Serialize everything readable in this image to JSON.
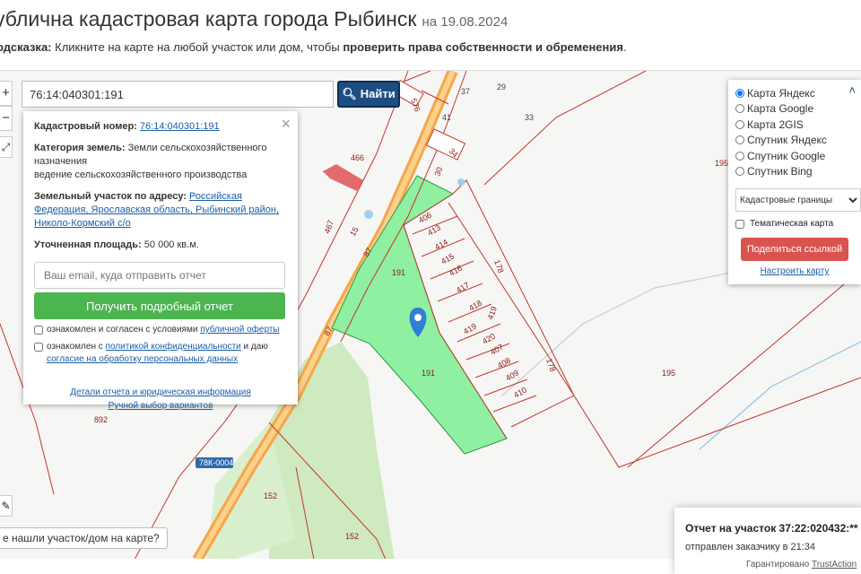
{
  "header": {
    "title": "ублична кадастровая карта города Рыбинск",
    "date": "на 19.08.2024",
    "hint_prefix": "одсказка:",
    "hint_text": " Кликните на карте на любой участок или дом, чтобы ",
    "hint_bold": "проверить права собственности и обременения",
    "hint_end": "."
  },
  "search": {
    "value": "76:14:040301:191",
    "button_label": "Найти"
  },
  "zoom": {
    "plus": "+",
    "minus": "−",
    "fullscreen": "⤢"
  },
  "info": {
    "close": "×",
    "cad_label": "Кадастровый номер:",
    "cad_value": "76:14:040301:191",
    "category_label": "Категория земель:",
    "category_value": "Земли сельскохозяйственного назначения",
    "category_extra": "ведение сельскохозяйственного производства",
    "address_label": "Земельный участок по адресу:",
    "address_value": "Российская Федерация, Ярославская область, Рыбинский район, Николо-Кормский с/о",
    "area_label": "Уточненная площадь:",
    "area_value": "50 000 кв.м.",
    "email_placeholder": "Ваш email, куда отправить отчет",
    "report_button": "Получить подробный отчет",
    "check1_text": "ознакомлен и согласен с условиями ",
    "check1_link": "публичной оферты",
    "check2_text": "ознакомлен с ",
    "check2_link": "политикой конфиденциальности",
    "check2_mid": " и даю ",
    "check2_link2": "согласие на обработку персональных данных",
    "link_details": "Детали отчета и юридическая информация",
    "link_manual": "Ручной выбор вариантов"
  },
  "layers": {
    "options": [
      {
        "label": "Карта Яндекс",
        "checked": true
      },
      {
        "label": "Карта Google",
        "checked": false
      },
      {
        "label": "Карта 2GIS",
        "checked": false
      },
      {
        "label": "Спутник Яндекс",
        "checked": false
      },
      {
        "label": "Спутник Google",
        "checked": false
      },
      {
        "label": "Спутник Bing",
        "checked": false
      }
    ],
    "select_value": "Кадастровые границы",
    "thematic_label": "Тематическая карта",
    "share_button": "Поделиться ссылкой",
    "configure_link": "Настроить карту"
  },
  "map_labels": {
    "parcels": [
      "406",
      "413",
      "414",
      "415",
      "416",
      "417",
      "418",
      "419",
      "419",
      "420",
      "407",
      "408",
      "409",
      "410",
      "178",
      "178",
      "191",
      "191",
      "195",
      "195",
      "466",
      "467",
      "15",
      "87",
      "87",
      "892",
      "152",
      "152",
      "30",
      "34",
      "37",
      "29",
      "41",
      "33",
      "576"
    ],
    "road": "78К-0004"
  },
  "not_found": "е нашли участок/дом на карте?",
  "toast": {
    "title": "Отчет на участок 37:22:020432:**",
    "subtitle": "отправлен заказчику в 21:34",
    "guarantee": "Гарантировано",
    "brand": "TrustAction"
  },
  "colors": {
    "parcel_fill": "#8ef0a0",
    "border_red": "#c0392b",
    "road_orange": "#f5a64a",
    "button_blue": "#1d4e82",
    "report_green": "#4cb550",
    "share_red": "#d9534f"
  }
}
